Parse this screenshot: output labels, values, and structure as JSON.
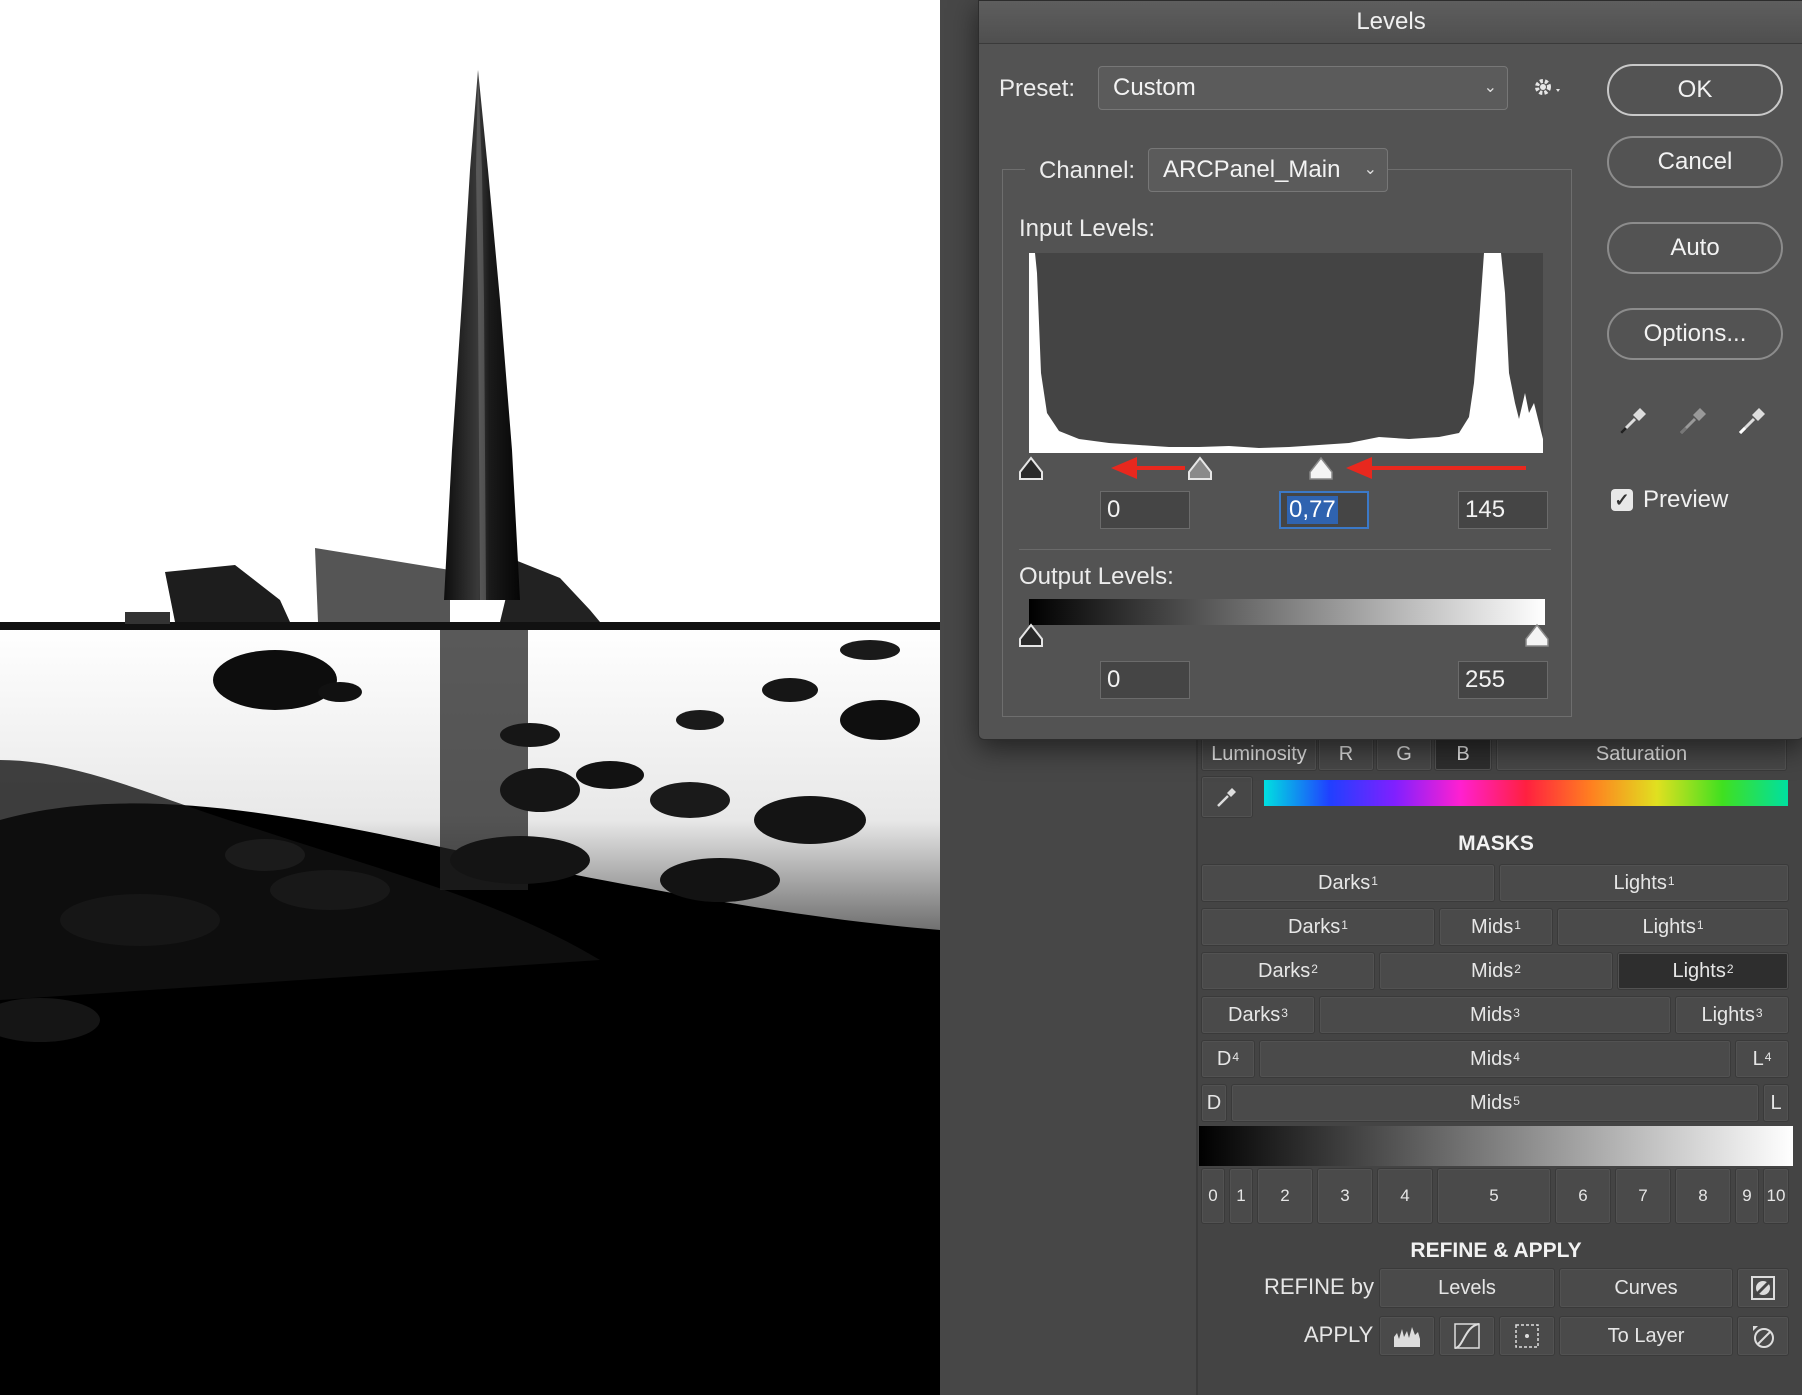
{
  "dialog": {
    "title": "Levels",
    "preset_label": "Preset:",
    "preset_value": "Custom",
    "channel_label": "Channel:",
    "channel_value": "ARCPanel_Main",
    "input_levels_label": "Input Levels:",
    "output_levels_label": "Output Levels:",
    "input_black": "0",
    "input_gamma": "0,77",
    "input_white": "145",
    "output_black": "0",
    "output_white": "255",
    "buttons": {
      "ok": "OK",
      "cancel": "Cancel",
      "auto": "Auto",
      "options": "Options..."
    },
    "preview_label": "Preview",
    "preview_checked": true,
    "icons": [
      "gear-icon",
      "black-point-eyedropper-icon",
      "gray-point-eyedropper-icon",
      "white-point-eyedropper-icon",
      "chevron-down-icon"
    ]
  },
  "panel": {
    "channel_tabs": [
      "Luminosity",
      "R",
      "G",
      "B",
      "Saturation"
    ],
    "masks_title": "MASKS",
    "mask_rows": [
      [
        {
          "label": "Darks",
          "sup": "1"
        },
        {
          "label": "Lights",
          "sup": "1"
        }
      ],
      [
        {
          "label": "Darks",
          "sup": "1"
        },
        {
          "label": "Mids",
          "sup": "1"
        },
        {
          "label": "Lights",
          "sup": "1"
        }
      ],
      [
        {
          "label": "Darks",
          "sup": "2"
        },
        {
          "label": "Mids",
          "sup": "2"
        },
        {
          "label": "Lights",
          "sup": "2"
        }
      ],
      [
        {
          "label": "Darks",
          "sup": "3"
        },
        {
          "label": "Mids",
          "sup": "3"
        },
        {
          "label": "Lights",
          "sup": "3"
        }
      ],
      [
        {
          "label": "D",
          "sup": "4"
        },
        {
          "label": "Mids",
          "sup": "4"
        },
        {
          "label": "L",
          "sup": "4"
        }
      ],
      [
        {
          "label": "D",
          "sup": ""
        },
        {
          "label": "Mids",
          "sup": "5"
        },
        {
          "label": "L",
          "sup": ""
        }
      ]
    ],
    "zone_numbers": [
      "0",
      "1",
      "2",
      "3",
      "4",
      "5",
      "6",
      "7",
      "8",
      "9",
      "10"
    ],
    "refine_title": "REFINE & APPLY",
    "refine_label": "REFINE by",
    "refine_buttons": [
      "Levels",
      "Curves"
    ],
    "apply_label": "APPLY",
    "apply_to_layer": "To Layer",
    "active_mask": "Lights 2",
    "active_channel_tab": "B"
  },
  "colors": {
    "dialog_bg": "#535353",
    "panel_bg": "#444444",
    "selection_blue": "#2f63b0",
    "arrow_red": "#e8281e"
  }
}
